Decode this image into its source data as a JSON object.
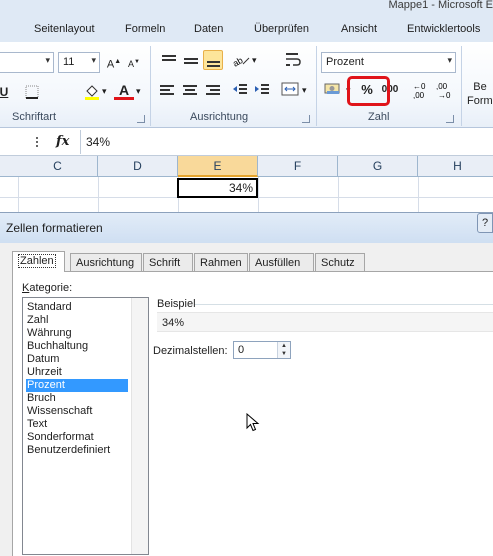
{
  "window": {
    "title": "Mappe1 - Microsoft E"
  },
  "ribbon": {
    "tabs": [
      "Seitenlayout",
      "Formeln",
      "Daten",
      "Überprüfen",
      "Ansicht",
      "Entwicklertools"
    ],
    "groups": {
      "schriftart_label": "Schriftart",
      "ausrichtung_label": "Ausrichtung",
      "zahl_label": "Zahl"
    },
    "font_size": "11",
    "number_format": "Prozent",
    "percent_button": "%",
    "thousands_button": "000",
    "underline_button": "U",
    "font_color_button": "A",
    "decimal_increase": "+0 ,00",
    "decimal_decrease": ",00 +0",
    "cut_off_button": "Be Forme",
    "highlight_color": "#e0141a"
  },
  "formula_bar": {
    "fx": "fx",
    "value": "34%"
  },
  "grid": {
    "columns": [
      "C",
      "D",
      "E",
      "F",
      "G",
      "H"
    ],
    "active_column": "E",
    "active_cell_value": "34%"
  },
  "dialog": {
    "title": "Zellen formatieren",
    "help": "?",
    "tabs": [
      "Zahlen",
      "Ausrichtung",
      "Schrift",
      "Rahmen",
      "Ausfüllen",
      "Schutz"
    ],
    "active_tab": "Zahlen",
    "kategorie_label": "Kategorie:",
    "categories": [
      "Standard",
      "Zahl",
      "Währung",
      "Buchhaltung",
      "Datum",
      "Uhrzeit",
      "Prozent",
      "Bruch",
      "Wissenschaft",
      "Text",
      "Sonderformat",
      "Benutzerdefiniert"
    ],
    "selected_category": "Prozent",
    "beispiel_label": "Beispiel",
    "beispiel_value": "34%",
    "dezimalstellen_label": "Dezimalstellen:",
    "dezimalstellen_value": "0"
  }
}
